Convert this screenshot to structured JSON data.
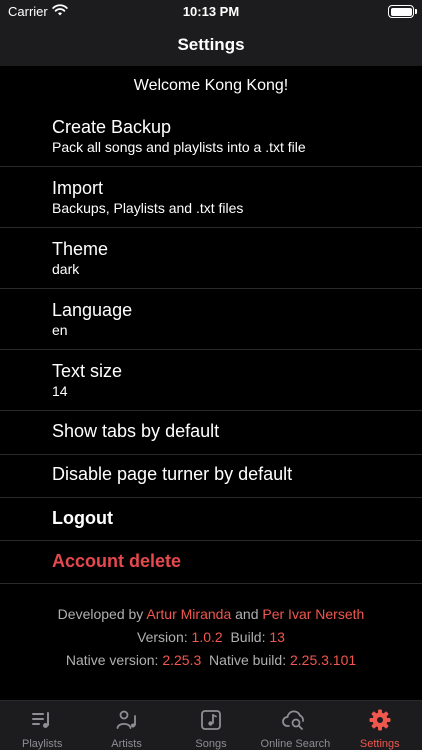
{
  "status_bar": {
    "carrier": "Carrier",
    "time": "10:13 PM"
  },
  "header": {
    "title": "Settings"
  },
  "welcome": "Welcome Kong Kong!",
  "rows": [
    {
      "label": "Create Backup",
      "sub": "Pack all songs and playlists into a .txt file"
    },
    {
      "label": "Import",
      "sub": "Backups, Playlists and .txt files"
    },
    {
      "label": "Theme",
      "sub": "dark"
    },
    {
      "label": "Language",
      "sub": "en"
    },
    {
      "label": "Text size",
      "sub": "14"
    },
    {
      "label": "Show tabs by default"
    },
    {
      "label": "Disable page turner by default"
    },
    {
      "label": "Logout"
    },
    {
      "label": "Account delete"
    }
  ],
  "footer": {
    "developed_by": "Developed by",
    "dev1": "Artur Miranda",
    "and": "and",
    "dev2": "Per Ivar Nerseth",
    "version_label": "Version:",
    "version": "1.0.2",
    "build_label": "Build:",
    "build": "13",
    "native_version_label": "Native version:",
    "native_version": "2.25.3",
    "native_build_label": "Native build:",
    "native_build": "2.25.3.101"
  },
  "tabs": [
    {
      "label": "Playlists",
      "icon": "playlist-icon"
    },
    {
      "label": "Artists",
      "icon": "artist-icon"
    },
    {
      "label": "Songs",
      "icon": "songs-icon"
    },
    {
      "label": "Online Search",
      "icon": "online-search-icon"
    },
    {
      "label": "Settings",
      "icon": "gear-icon",
      "active": true
    }
  ],
  "colors": {
    "accent": "#f0574e",
    "background": "#000000",
    "bar": "#1c1c1e",
    "danger": "#e5484d"
  }
}
